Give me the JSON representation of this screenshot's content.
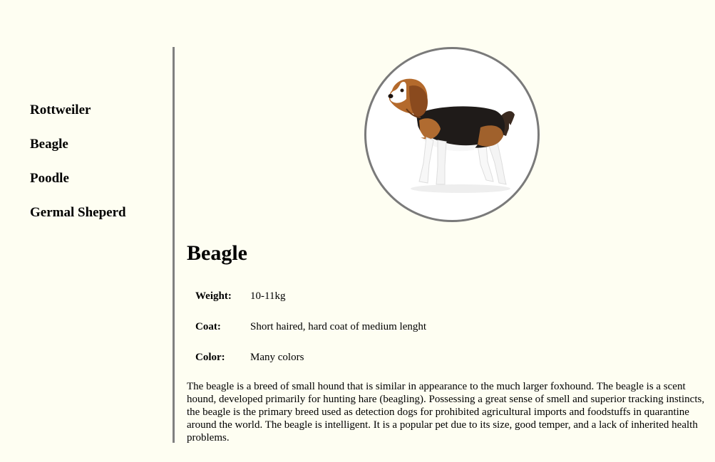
{
  "sidebar": {
    "items": [
      {
        "label": "Rottweiler"
      },
      {
        "label": "Beagle"
      },
      {
        "label": "Poodle"
      },
      {
        "label": "Germal Sheperd"
      }
    ]
  },
  "breed": {
    "name": "Beagle",
    "image_alt": "beagle-photo",
    "facts": [
      {
        "key": "Weight:",
        "value": "10-11kg"
      },
      {
        "key": "Coat:",
        "value": "Short haired, hard coat of medium lenght"
      },
      {
        "key": "Color:",
        "value": "Many colors"
      }
    ],
    "description": "The beagle is a breed of small hound that is similar in appearance to the much larger foxhound. The beagle is a scent hound, developed primarily for hunting hare (beagling). Possessing a great sense of smell and superior tracking instincts, the beagle is the primary breed used as detection dogs for prohibited agricultural imports and foodstuffs in quarantine around the world. The beagle is intelligent. It is a popular pet due to its size, good temper, and a lack of inherited health problems."
  },
  "colors": {
    "background": "#fefef2",
    "divider": "#808080",
    "portrait_border": "#7a7a7a"
  }
}
